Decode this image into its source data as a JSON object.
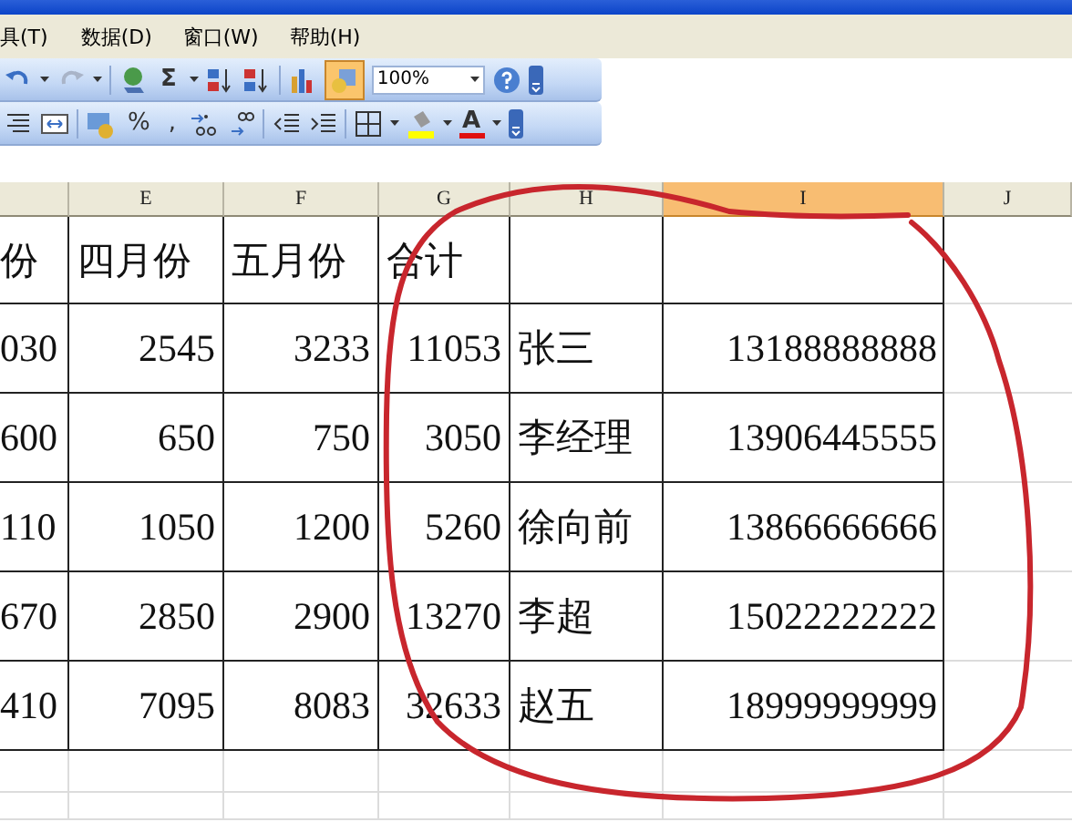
{
  "menu_bar": [
    {
      "label": "具(T)"
    },
    {
      "label": "数据(D)"
    },
    {
      "label": "窗口(W)"
    },
    {
      "label": "帮助(H)"
    }
  ],
  "standard_toolbar": {
    "sum_symbol": "Σ",
    "zoom": "100%",
    "drawing_selected": true
  },
  "format_toolbar": {
    "percent": "%",
    "comma": ",",
    "font_color_letter": "A"
  },
  "sheet": {
    "columns": [
      {
        "selected": false
      },
      {
        "label": "E",
        "selected": false
      },
      {
        "label": "F",
        "selected": false
      },
      {
        "label": "G",
        "selected": false
      },
      {
        "label": "H",
        "selected": false
      },
      {
        "label": "I",
        "selected": true
      },
      {
        "label": "J",
        "selected": false
      }
    ],
    "header_row": [
      "份",
      "四月份",
      "五月份",
      "合计"
    ],
    "rows": [
      [
        "030",
        "2545",
        "3233",
        "11053",
        "张三",
        "13188888888"
      ],
      [
        "600",
        "650",
        "750",
        "3050",
        "李经理",
        "13906445555"
      ],
      [
        "110",
        "1050",
        "1200",
        "5260",
        "徐向前",
        "13866666666"
      ],
      [
        "670",
        "2850",
        "2900",
        "13270",
        "李超",
        "15022222222"
      ],
      [
        "410",
        "7095",
        "8083",
        "32633",
        "赵五",
        "18999999999"
      ]
    ]
  }
}
